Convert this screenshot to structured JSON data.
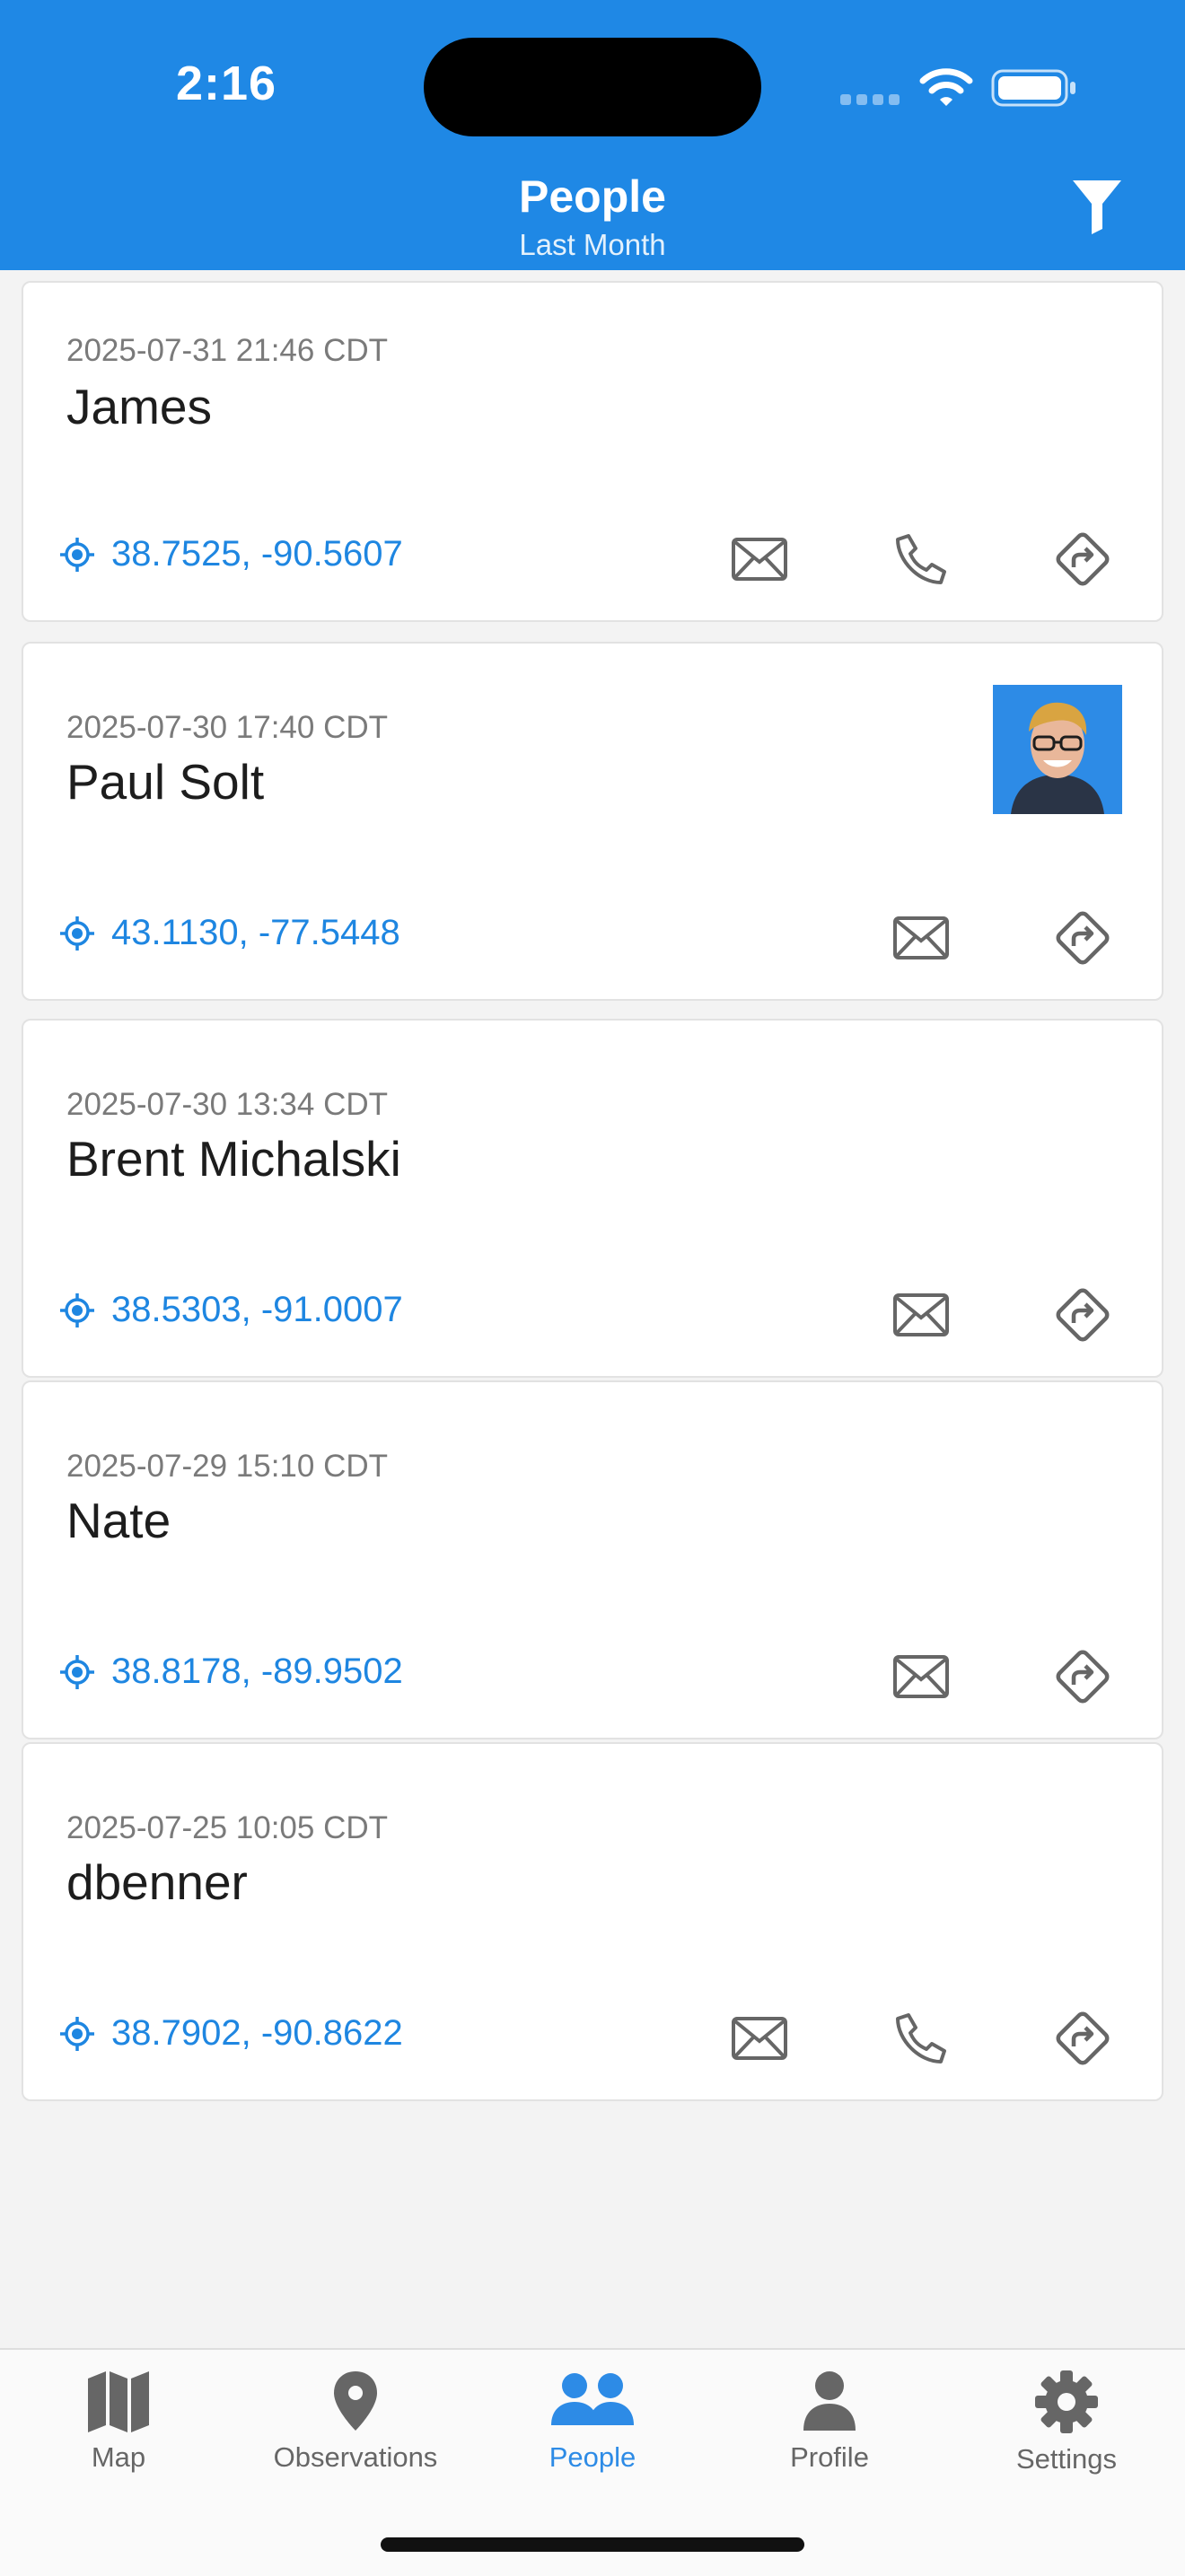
{
  "status_bar": {
    "time": "2:16"
  },
  "header": {
    "title": "People",
    "subtitle": "Last Month"
  },
  "people": [
    {
      "timestamp": "2025-07-31 21:46 CDT",
      "name": "James",
      "location": "38.7525, -90.5607",
      "has_phone": true,
      "has_avatar": false
    },
    {
      "timestamp": "2025-07-30 17:40 CDT",
      "name": "Paul Solt",
      "location": "43.1130, -77.5448",
      "has_phone": false,
      "has_avatar": true
    },
    {
      "timestamp": "2025-07-30 13:34 CDT",
      "name": "Brent Michalski",
      "location": "38.5303, -91.0007",
      "has_phone": false,
      "has_avatar": false
    },
    {
      "timestamp": "2025-07-29 15:10 CDT",
      "name": "Nate",
      "location": "38.8178, -89.9502",
      "has_phone": false,
      "has_avatar": false
    },
    {
      "timestamp": "2025-07-25 10:05 CDT",
      "name": "dbenner",
      "location": "38.7902, -90.8622",
      "has_phone": true,
      "has_avatar": false
    }
  ],
  "tabs": [
    {
      "label": "Map",
      "icon": "map-icon"
    },
    {
      "label": "Observations",
      "icon": "pin-icon"
    },
    {
      "label": "People",
      "icon": "people-icon",
      "active": true
    },
    {
      "label": "Profile",
      "icon": "person-icon"
    },
    {
      "label": "Settings",
      "icon": "gear-icon"
    }
  ],
  "colors": {
    "header": "#1f88e5",
    "accent": "#1e86e1",
    "icon_gray": "#666666"
  }
}
